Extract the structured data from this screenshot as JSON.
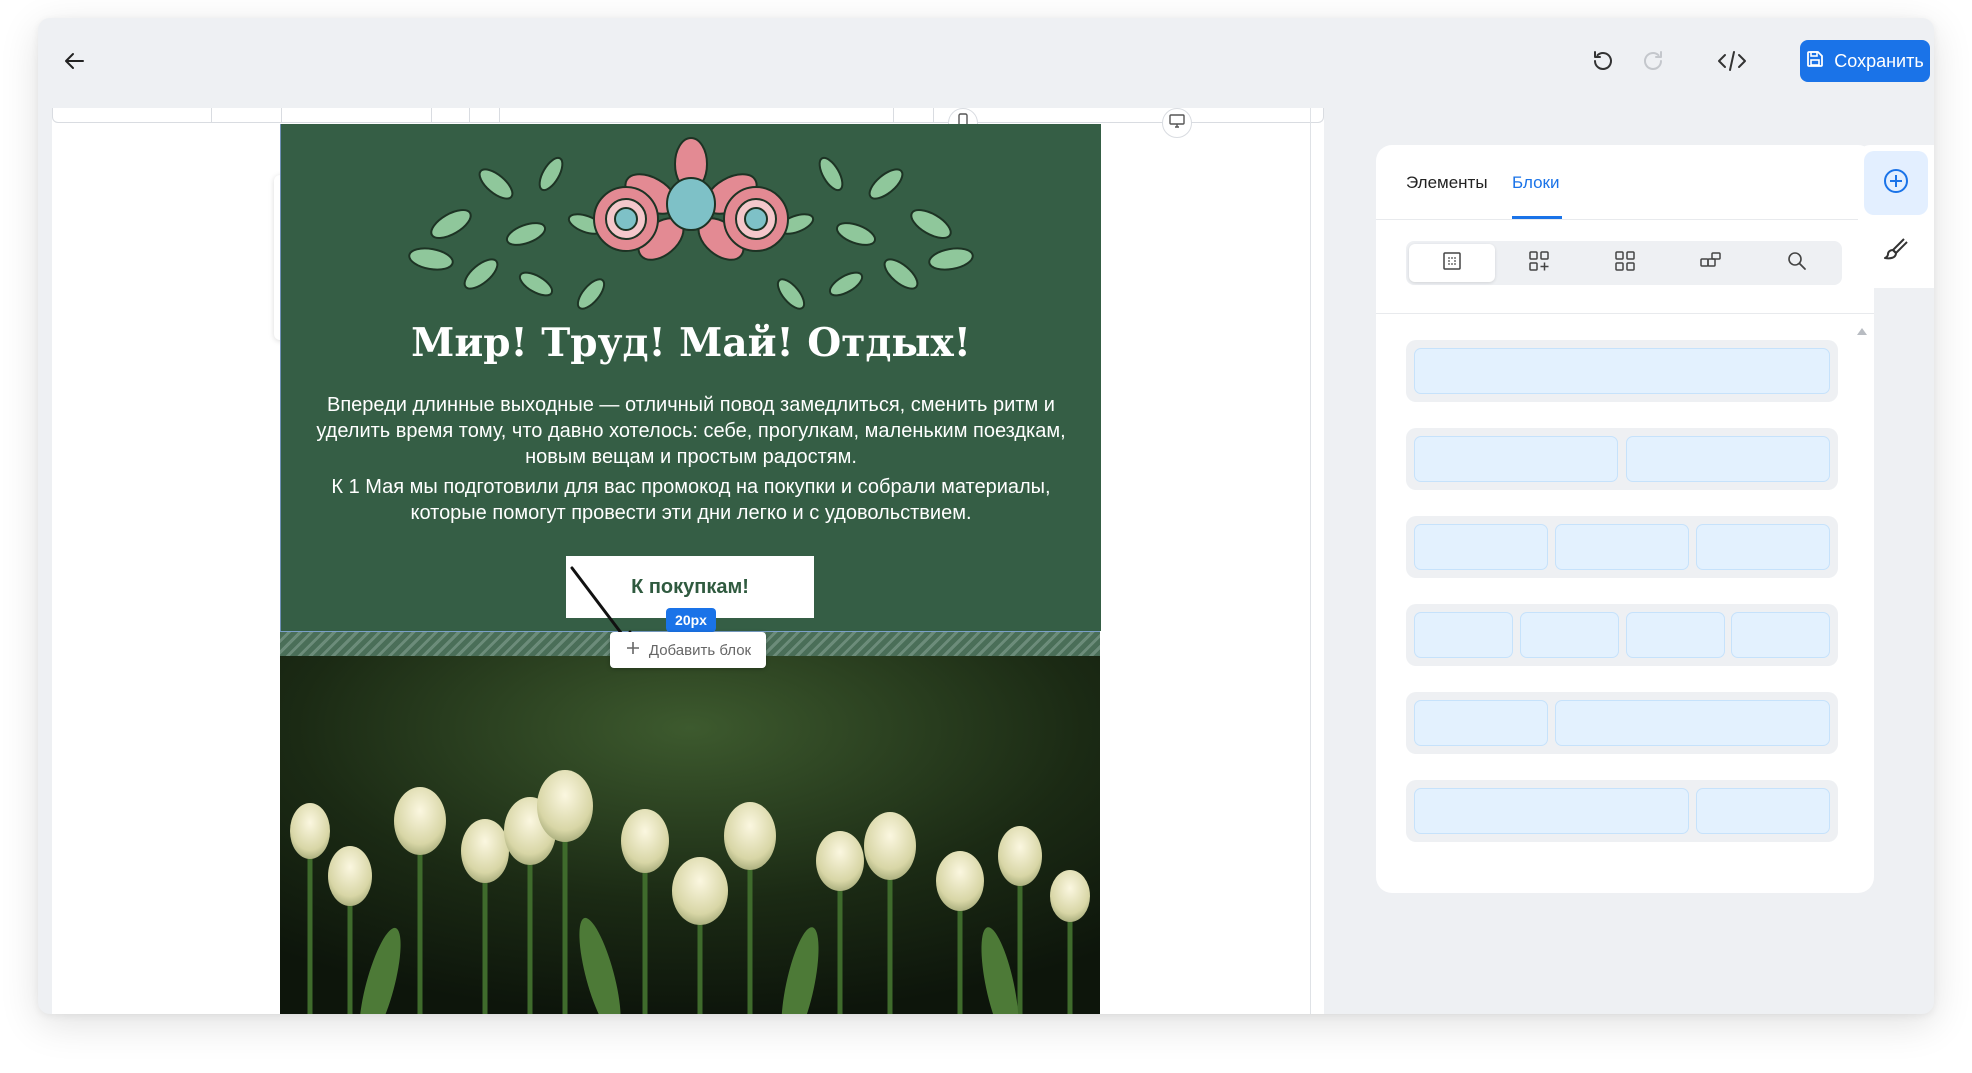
{
  "topbar": {
    "back_icon": "arrow-left-icon",
    "undo_icon": "undo-icon",
    "redo_icon": "redo-icon",
    "code_icon": "code-icon",
    "save_label": "Сохранить",
    "save_icon": "floppy-disk-icon"
  },
  "canvas": {
    "device_icons": [
      "mobile-icon",
      "desktop-icon"
    ],
    "block_toolbar_icons": [
      "drag-handle-icon",
      "pencil-icon",
      "copy-icon",
      "floppy-disk-icon",
      "trash-icon"
    ]
  },
  "email": {
    "title": "Мир! Труд! Май! Отдых!",
    "paragraph_1": "Впереди длинные выходные — отличный повод замедлиться, сменить ритм и уделить время тому, что давно хотелось: себе, прогулкам, маленьким поездкам, новым вещам и простым радостям.",
    "paragraph_2": "К 1 Мая мы подготовили для вас промокод на покупки и собрали материалы, которые помогут провести эти дни легко и с удовольствием.",
    "cta_label": "К покупкам!",
    "spacer_size": "20px",
    "add_block_label": "Добавить блок",
    "hero_color": "#355e45",
    "cta_text_color": "#2f5a3f"
  },
  "panel": {
    "tabs": [
      {
        "label": "Элементы",
        "active": false
      },
      {
        "label": "Блоки",
        "active": true
      }
    ],
    "segment_icons": [
      "single-cell-icon",
      "add-grid-icon",
      "grid-icon",
      "blocks-icon",
      "search-icon"
    ],
    "layouts": [
      {
        "columns": 1
      },
      {
        "columns": 2
      },
      {
        "columns": 3
      },
      {
        "columns": 4
      },
      {
        "columns": 2,
        "variant": "1-2"
      },
      {
        "columns": 2,
        "variant": "2-1"
      }
    ]
  },
  "side_rail": {
    "icons": [
      "add-circle-icon",
      "brush-icon"
    ]
  },
  "colors": {
    "accent": "#1a73e8",
    "cell_fill": "#e3f1fe",
    "window_bg": "#eef0f3"
  }
}
